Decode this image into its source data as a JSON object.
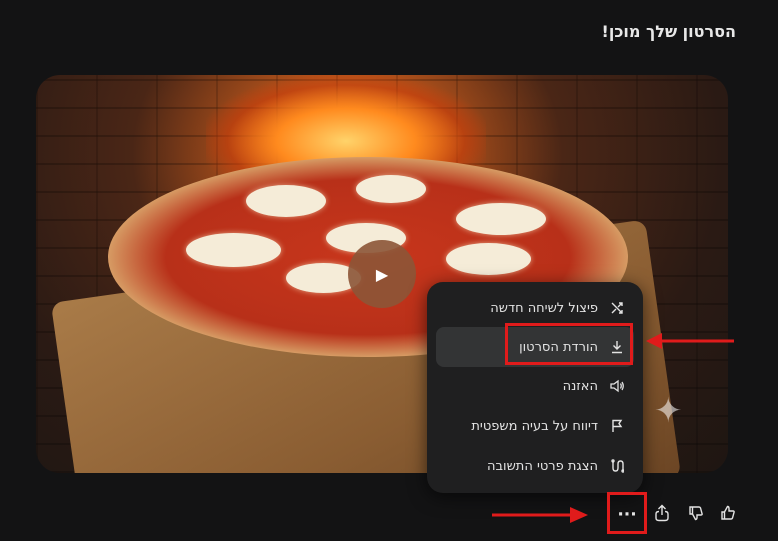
{
  "header": {
    "title": "הסרטון שלך מוכן!"
  },
  "video": {
    "play_icon": "play-icon"
  },
  "menu": {
    "items": [
      {
        "label": "פיצול לשיחה חדשה",
        "icon": "branch-icon"
      },
      {
        "label": "הורדת הסרטון",
        "icon": "download-icon",
        "active": true
      },
      {
        "label": "האזנה",
        "icon": "speaker-icon"
      },
      {
        "label": "דיווח על בעיה משפטית",
        "icon": "flag-icon"
      },
      {
        "label": "הצגת פרטי התשובה",
        "icon": "details-icon"
      }
    ]
  },
  "actions": {
    "more_label": "···",
    "items": [
      "thumbs-up-icon",
      "thumbs-down-icon",
      "share-icon",
      "more-icon"
    ]
  },
  "colors": {
    "annotation_red": "#e01b1b",
    "background": "#131314",
    "menu_bg": "#1f1f20"
  }
}
